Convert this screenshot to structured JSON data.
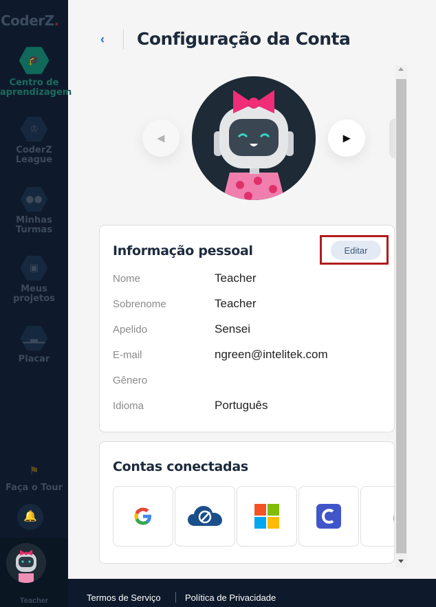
{
  "app": {
    "logo_text": "CoderZ"
  },
  "sidebar": {
    "items": [
      {
        "label": "Centro de aprendizagem",
        "icon": "graduation-cap-icon",
        "active": true
      },
      {
        "label": "CoderZ League",
        "icon": "trophy-icon",
        "active": false
      },
      {
        "label": "Minhas Turmas",
        "icon": "group-icon",
        "active": false
      },
      {
        "label": "Meus projetos",
        "icon": "briefcase-icon",
        "active": false
      },
      {
        "label": "Placar",
        "icon": "podium-icon",
        "active": false
      }
    ],
    "tour_label": "Faça o Tour",
    "user_name": "Teacher"
  },
  "header": {
    "title": "Configuração da Conta"
  },
  "personal": {
    "title": "Informação pessoal",
    "edit_label": "Editar",
    "fields": [
      {
        "label": "Nome",
        "value": "Teacher"
      },
      {
        "label": "Sobrenome",
        "value": "Teacher"
      },
      {
        "label": "Apelido",
        "value": "Sensei"
      },
      {
        "label": "E-mail",
        "value": "ngreen@intelitek.com"
      },
      {
        "label": "Gênero",
        "value": ""
      },
      {
        "label": "Idioma",
        "value": "Português"
      }
    ]
  },
  "accounts": {
    "title": "Contas conectadas",
    "providers": [
      "google-icon",
      "cloud-icon",
      "microsoft-icon",
      "c-icon",
      "owl-icon"
    ]
  },
  "footer": {
    "terms": "Termos de Serviço",
    "privacy": "Política de Privacidade"
  },
  "colors": {
    "sidebar_bg": "#0e1a2b",
    "accent_blue": "#1a6fd6",
    "edit_bg": "#e3eaf4",
    "highlight_red": "#b01b1b"
  }
}
